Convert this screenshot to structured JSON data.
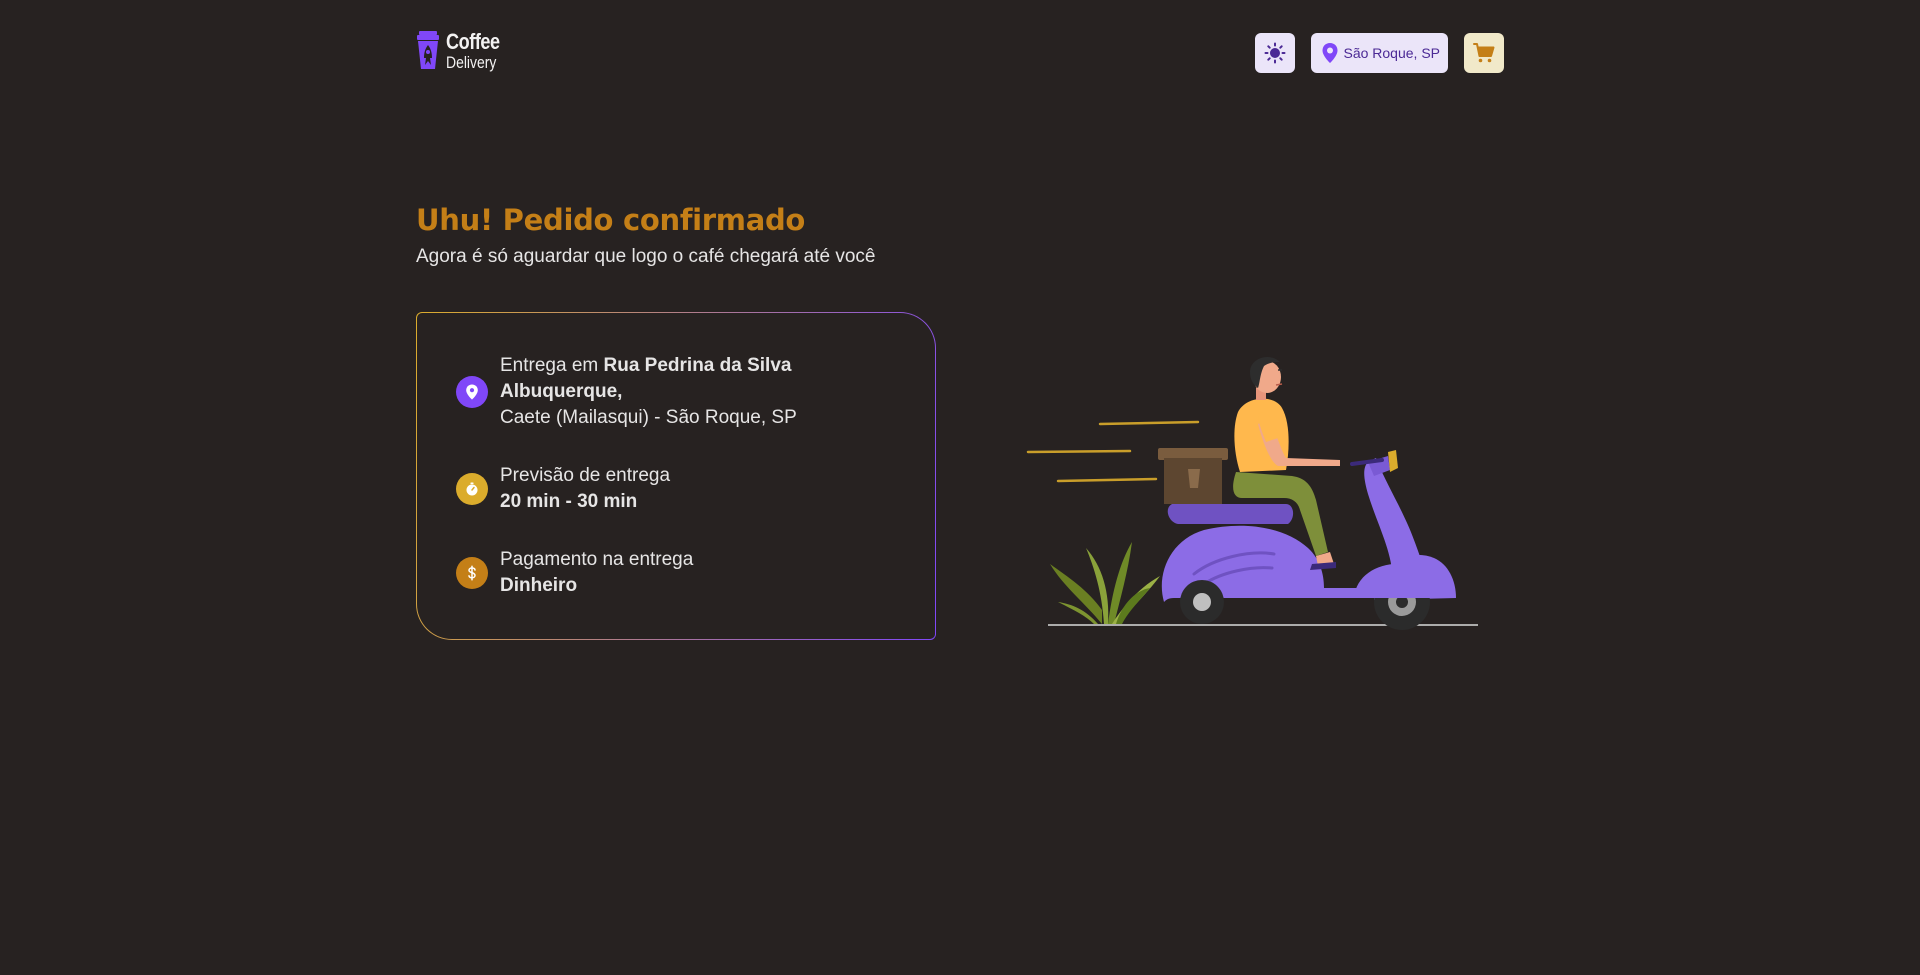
{
  "header": {
    "logo": {
      "line1": "Coffee",
      "line2": "Delivery",
      "icon": "coffee-cup-rocket-icon"
    },
    "theme_icon": "sun-icon",
    "location": {
      "icon": "map-pin-icon",
      "label": "São Roque, SP"
    },
    "cart_icon": "shopping-cart-icon"
  },
  "main": {
    "title": "Uhu! Pedido confirmado",
    "subtitle": "Agora é só aguardar que logo o café chegará até você",
    "delivery": {
      "icon": "map-pin-icon",
      "prefix": "Entrega em ",
      "street": "Rua Pedrina da Silva Albuquerque,",
      "district": "Caete (Mailasqui) - São Roque, SP"
    },
    "forecast": {
      "icon": "timer-icon",
      "label": "Previsão de entrega",
      "value": "20 min - 30 min"
    },
    "payment": {
      "icon": "currency-dollar-icon",
      "label": "Pagamento na entrega",
      "value": "Dinheiro"
    }
  },
  "colors": {
    "background": "#272221",
    "purple": "#8047f8",
    "purple_dark": "#4b2995",
    "purple_light": "#ebe5f9",
    "yellow": "#dbac2c",
    "yellow_dark": "#c47f17",
    "yellow_light": "#f1e9c9",
    "text": "#e6e5e5"
  }
}
